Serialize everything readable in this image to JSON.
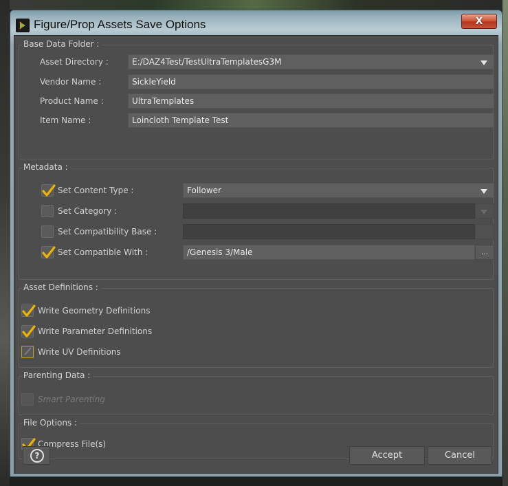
{
  "window": {
    "title": "Figure/Prop Assets Save Options",
    "close_glyph": "X",
    "app_icon": "daz-studio-icon",
    "accent": "#f0b400"
  },
  "base_data_folder": {
    "label": "Base Data Folder :",
    "asset_directory": {
      "label": "Asset Directory :",
      "value": "E:/DAZ4Test/TestUltraTemplatesG3M"
    },
    "vendor_name": {
      "label": "Vendor Name :",
      "value": "SickleYield"
    },
    "product_name": {
      "label": "Product Name :",
      "value": "UltraTemplates"
    },
    "item_name": {
      "label": "Item Name :",
      "value": "Loincloth Template Test"
    }
  },
  "metadata": {
    "label": "Metadata :",
    "content_type": {
      "label": "Set Content Type :",
      "checked": true,
      "value": "Follower"
    },
    "category": {
      "label": "Set Category :",
      "checked": false,
      "value": ""
    },
    "compatibility_base": {
      "label": "Set Compatibility Base :",
      "checked": false,
      "value": ""
    },
    "compatible_with": {
      "label": "Set Compatible With :",
      "checked": true,
      "value": "/Genesis 3/Male",
      "browse_label": "..."
    }
  },
  "asset_definitions": {
    "label": "Asset Definitions :",
    "geometry": {
      "label": "Write Geometry Definitions",
      "state": "checked"
    },
    "parameter": {
      "label": "Write Parameter Definitions",
      "state": "checked"
    },
    "uv": {
      "label": "Write UV Definitions",
      "state": "partial"
    }
  },
  "parenting_data": {
    "label": "Parenting Data :",
    "smart_parenting": {
      "label": "Smart Parenting",
      "state": "disabled"
    }
  },
  "file_options": {
    "label": "File Options :",
    "compress": {
      "label": "Compress File(s)",
      "state": "checked"
    }
  },
  "buttons": {
    "help": "?",
    "accept": "Accept",
    "cancel": "Cancel"
  }
}
